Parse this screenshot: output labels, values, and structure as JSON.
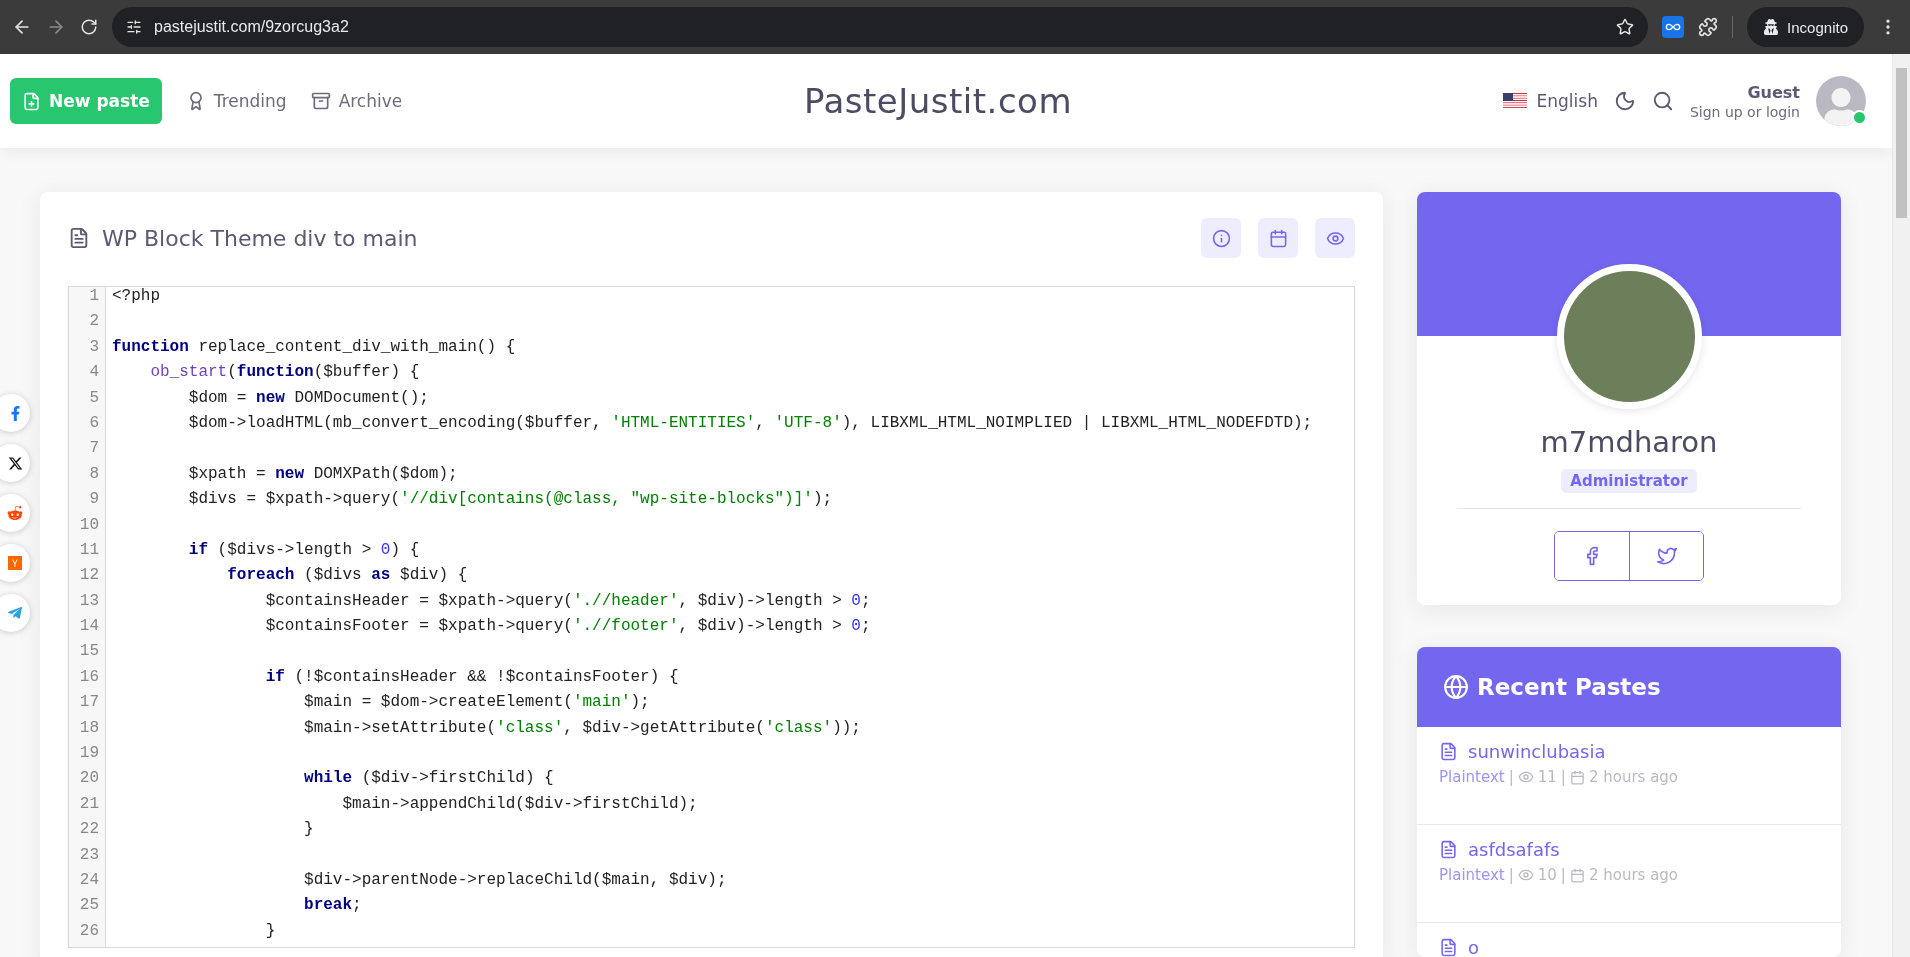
{
  "browser": {
    "url": "pastejustit.com/9zorcug3a2",
    "profile_label": "Incognito"
  },
  "header": {
    "new_paste": "New paste",
    "nav": [
      {
        "label": "Trending",
        "kind": "trending"
      },
      {
        "label": "Archive",
        "kind": "archive"
      }
    ],
    "brand": "PasteJustit.com",
    "language": "English",
    "user": {
      "name": "Guest",
      "subtitle": "Sign up or login",
      "online": true
    }
  },
  "share_buttons": [
    {
      "kind": "facebook"
    },
    {
      "kind": "x"
    },
    {
      "kind": "reddit"
    },
    {
      "kind": "ycombinator"
    },
    {
      "kind": "telegram"
    }
  ],
  "paste": {
    "title": "WP Block Theme div to main",
    "lines": [
      {
        "n": "1",
        "code": [
          {
            "kind": "plain",
            "text": "<?php"
          }
        ]
      },
      {
        "n": "2"
      },
      {
        "n": "3",
        "code": [
          {
            "kind": "kw",
            "text": "function"
          },
          {
            "kind": "plain",
            "text": " replace_content_div_with_main() {"
          }
        ]
      },
      {
        "n": "4",
        "code": [
          {
            "kind": "fn",
            "text": "    ob_start"
          },
          {
            "kind": "plain",
            "text": "("
          },
          {
            "kind": "kw",
            "text": "function"
          },
          {
            "kind": "plain",
            "text": "($buffer) {"
          }
        ]
      },
      {
        "n": "5",
        "code": [
          {
            "kind": "plain",
            "text": "        $dom = "
          },
          {
            "kind": "kw",
            "text": "new"
          },
          {
            "kind": "plain",
            "text": " DOMDocument();"
          }
        ]
      },
      {
        "n": "6",
        "code": [
          {
            "kind": "plain",
            "text": "        $dom->loadHTML(mb_convert_encoding($buffer, "
          },
          {
            "kind": "str",
            "text": "'HTML-ENTITIES'"
          },
          {
            "kind": "plain",
            "text": ", "
          },
          {
            "kind": "str",
            "text": "'UTF-8'"
          },
          {
            "kind": "plain",
            "text": "), LIBXML_HTML_NOIMPLIED | LIBXML_HTML_NODEFDTD);"
          }
        ]
      },
      {
        "n": "7"
      },
      {
        "n": "8",
        "code": [
          {
            "kind": "plain",
            "text": "        $xpath = "
          },
          {
            "kind": "kw",
            "text": "new"
          },
          {
            "kind": "plain",
            "text": " DOMXPath($dom);"
          }
        ]
      },
      {
        "n": "9",
        "code": [
          {
            "kind": "plain",
            "text": "        $divs = $xpath->query("
          },
          {
            "kind": "str",
            "text": "'//div[contains(@class, \"wp-site-blocks\")]'"
          },
          {
            "kind": "plain",
            "text": ");"
          }
        ]
      },
      {
        "n": "10"
      },
      {
        "n": "11",
        "code": [
          {
            "kind": "kw",
            "text": "        if"
          },
          {
            "kind": "plain",
            "text": " ($divs->length > "
          },
          {
            "kind": "num",
            "text": "0"
          },
          {
            "kind": "plain",
            "text": ") {"
          }
        ]
      },
      {
        "n": "12",
        "code": [
          {
            "kind": "kw",
            "text": "            foreach"
          },
          {
            "kind": "plain",
            "text": " ($divs "
          },
          {
            "kind": "kw",
            "text": "as"
          },
          {
            "kind": "plain",
            "text": " $div) {"
          }
        ]
      },
      {
        "n": "13",
        "code": [
          {
            "kind": "plain",
            "text": "                $containsHeader = $xpath->query("
          },
          {
            "kind": "str",
            "text": "'.//header'"
          },
          {
            "kind": "plain",
            "text": ", $div)->length > "
          },
          {
            "kind": "num",
            "text": "0"
          },
          {
            "kind": "plain",
            "text": ";"
          }
        ]
      },
      {
        "n": "14",
        "code": [
          {
            "kind": "plain",
            "text": "                $containsFooter = $xpath->query("
          },
          {
            "kind": "str",
            "text": "'.//footer'"
          },
          {
            "kind": "plain",
            "text": ", $div)->length > "
          },
          {
            "kind": "num",
            "text": "0"
          },
          {
            "kind": "plain",
            "text": ";"
          }
        ]
      },
      {
        "n": "15"
      },
      {
        "n": "16",
        "code": [
          {
            "kind": "kw",
            "text": "                if"
          },
          {
            "kind": "plain",
            "text": " (!$containsHeader && !$containsFooter) {"
          }
        ]
      },
      {
        "n": "17",
        "code": [
          {
            "kind": "plain",
            "text": "                    $main = $dom->createElement("
          },
          {
            "kind": "str",
            "text": "'main'"
          },
          {
            "kind": "plain",
            "text": ");"
          }
        ]
      },
      {
        "n": "18",
        "code": [
          {
            "kind": "plain",
            "text": "                    $main->setAttribute("
          },
          {
            "kind": "str",
            "text": "'class'"
          },
          {
            "kind": "plain",
            "text": ", $div->getAttribute("
          },
          {
            "kind": "str",
            "text": "'class'"
          },
          {
            "kind": "plain",
            "text": "));"
          }
        ]
      },
      {
        "n": "19"
      },
      {
        "n": "20",
        "code": [
          {
            "kind": "kw",
            "text": "                    while"
          },
          {
            "kind": "plain",
            "text": " ($div->firstChild) {"
          }
        ]
      },
      {
        "n": "21",
        "code": [
          {
            "kind": "plain",
            "text": "                        $main->appendChild($div->firstChild);"
          }
        ]
      },
      {
        "n": "22",
        "code": [
          {
            "kind": "plain",
            "text": "                    }"
          }
        ]
      },
      {
        "n": "23"
      },
      {
        "n": "24",
        "code": [
          {
            "kind": "plain",
            "text": "                    $div->parentNode->replaceChild($main, $div);"
          }
        ]
      },
      {
        "n": "25",
        "code": [
          {
            "kind": "kw",
            "text": "                    break"
          },
          {
            "kind": "plain",
            "text": ";"
          }
        ]
      },
      {
        "n": "26",
        "code": [
          {
            "kind": "plain",
            "text": "                }"
          }
        ]
      }
    ]
  },
  "profile": {
    "username": "m7mdharon",
    "role": "Administrator"
  },
  "recent": {
    "title": "Recent Pastes",
    "items": [
      {
        "title": "sunwinclubasia",
        "language": "Plaintext",
        "separators": [
          "|",
          "|"
        ],
        "views": "11",
        "time": "2 hours ago"
      },
      {
        "title": "asfdsafafs",
        "language": "Plaintext",
        "separators": [
          "|",
          "|"
        ],
        "views": "10",
        "time": "2 hours ago"
      },
      {
        "title": "o"
      }
    ]
  }
}
